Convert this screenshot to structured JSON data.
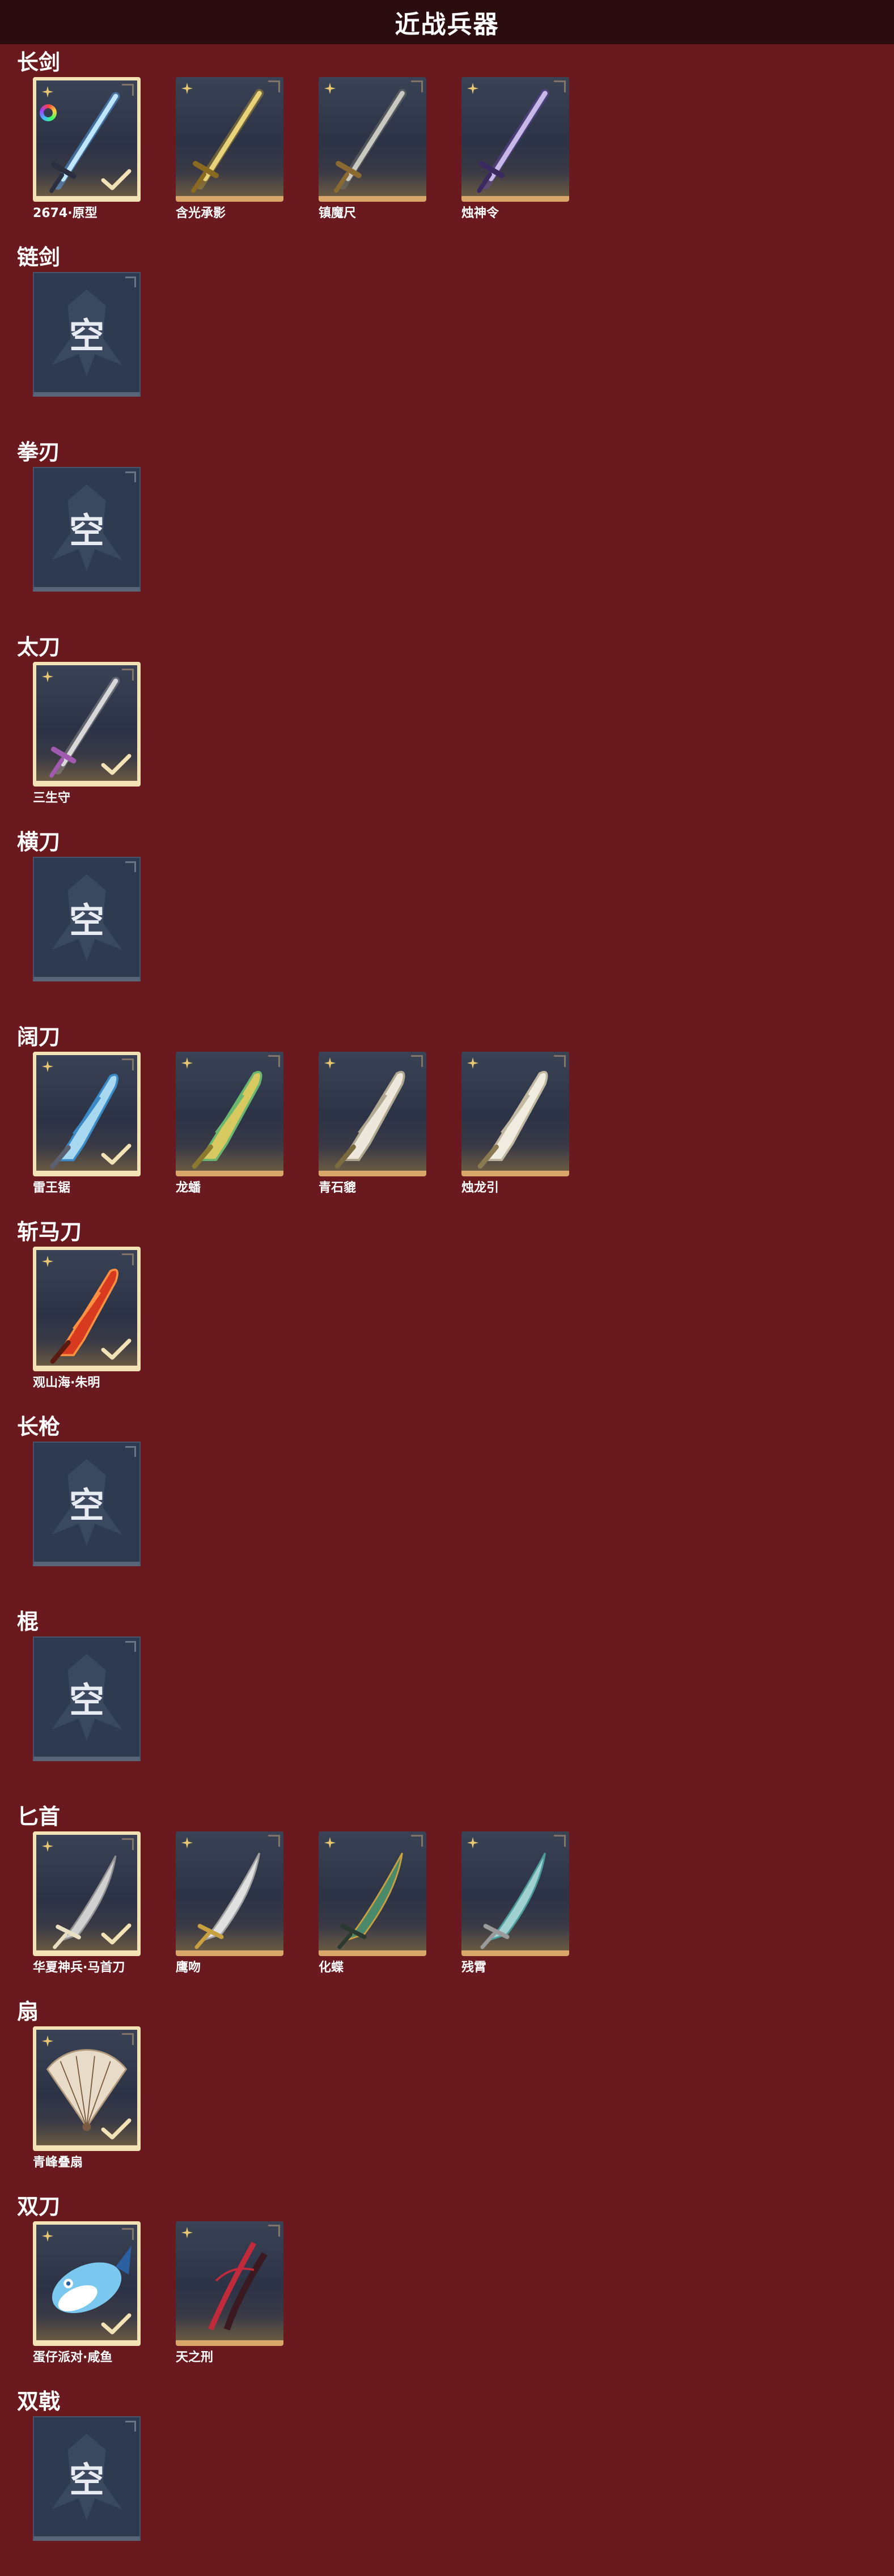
{
  "header": {
    "title": "近战兵器"
  },
  "empty_label": "空",
  "sections": [
    {
      "title": "长剑",
      "items": [
        {
          "name": "2674·原型",
          "selected": true,
          "rainbow": true,
          "weapon": "longsword-blue"
        },
        {
          "name": "含光承影",
          "selected": false,
          "weapon": "longsword-gold"
        },
        {
          "name": "镇魔尺",
          "selected": false,
          "weapon": "longsword-steel"
        },
        {
          "name": "烛神令",
          "selected": false,
          "weapon": "longsword-purple"
        }
      ]
    },
    {
      "title": "链剑",
      "items": []
    },
    {
      "title": "拳刃",
      "items": []
    },
    {
      "title": "太刀",
      "items": [
        {
          "name": "三生守",
          "selected": true,
          "weapon": "katana-silver"
        }
      ]
    },
    {
      "title": "横刀",
      "items": []
    },
    {
      "title": "阔刀",
      "items": [
        {
          "name": "雷王锯",
          "selected": true,
          "weapon": "broad-blue"
        },
        {
          "name": "龙蟠",
          "selected": false,
          "weapon": "broad-gold"
        },
        {
          "name": "青石貔",
          "selected": false,
          "weapon": "broad-white"
        },
        {
          "name": "烛龙引",
          "selected": false,
          "weapon": "broad-pale"
        }
      ]
    },
    {
      "title": "斩马刀",
      "items": [
        {
          "name": "观山海·朱明",
          "selected": true,
          "weapon": "zhanma-red"
        }
      ]
    },
    {
      "title": "长枪",
      "items": []
    },
    {
      "title": "棍",
      "items": []
    },
    {
      "title": "匕首",
      "items": [
        {
          "name": "华夏神兵·马首刀",
          "selected": true,
          "weapon": "dagger-steel"
        },
        {
          "name": "鹰吻",
          "selected": false,
          "weapon": "dagger-curved"
        },
        {
          "name": "化蝶",
          "selected": false,
          "weapon": "dagger-jade"
        },
        {
          "name": "残霄",
          "selected": false,
          "weapon": "dagger-teal"
        }
      ]
    },
    {
      "title": "扇",
      "items": [
        {
          "name": "青峰叠扇",
          "selected": true,
          "weapon": "fan"
        }
      ]
    },
    {
      "title": "双刀",
      "items": [
        {
          "name": "蛋仔派对·咸鱼",
          "selected": true,
          "weapon": "fish"
        },
        {
          "name": "天之刑",
          "selected": false,
          "weapon": "dual-red"
        }
      ]
    },
    {
      "title": "双戟",
      "items": []
    }
  ],
  "colors": {
    "background": "#6a1a1e",
    "header": "#2b0c0f",
    "selected_border": "#f2e2b4",
    "card_bottom": "#d9a66a",
    "empty_card": "#2e3a50"
  }
}
